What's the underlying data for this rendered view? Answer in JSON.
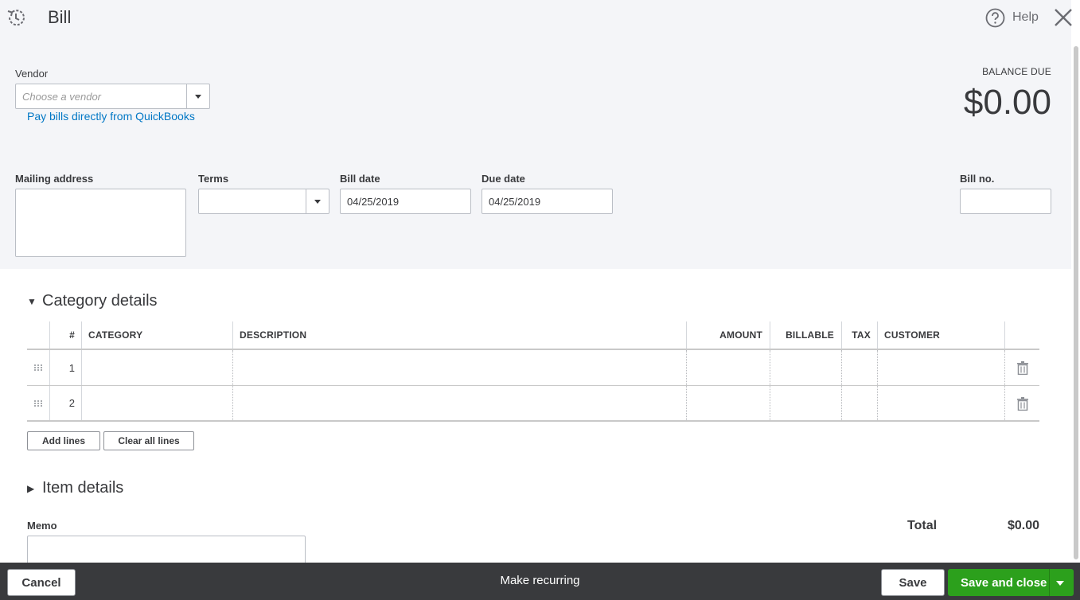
{
  "header": {
    "title": "Bill",
    "help_label": "Help"
  },
  "vendor": {
    "label": "Vendor",
    "placeholder": "Choose a vendor",
    "pay_link": "Pay bills directly from QuickBooks"
  },
  "balance": {
    "label": "BALANCE DUE",
    "amount": "$0.00"
  },
  "fields": {
    "mailing_label": "Mailing address",
    "terms_label": "Terms",
    "bill_date_label": "Bill date",
    "bill_date_value": "04/25/2019",
    "due_date_label": "Due date",
    "due_date_value": "04/25/2019",
    "bill_no_label": "Bill no."
  },
  "category": {
    "title": "Category details",
    "columns": [
      "#",
      "CATEGORY",
      "DESCRIPTION",
      "AMOUNT",
      "BILLABLE",
      "TAX",
      "CUSTOMER"
    ],
    "rows": [
      {
        "num": "1"
      },
      {
        "num": "2"
      }
    ],
    "add_lines": "Add lines",
    "clear_lines": "Clear all lines"
  },
  "items": {
    "title": "Item details"
  },
  "memo": {
    "label": "Memo"
  },
  "total": {
    "label": "Total",
    "value": "$0.00"
  },
  "footer": {
    "cancel": "Cancel",
    "recurring": "Make recurring",
    "save": "Save",
    "save_close": "Save and close"
  }
}
